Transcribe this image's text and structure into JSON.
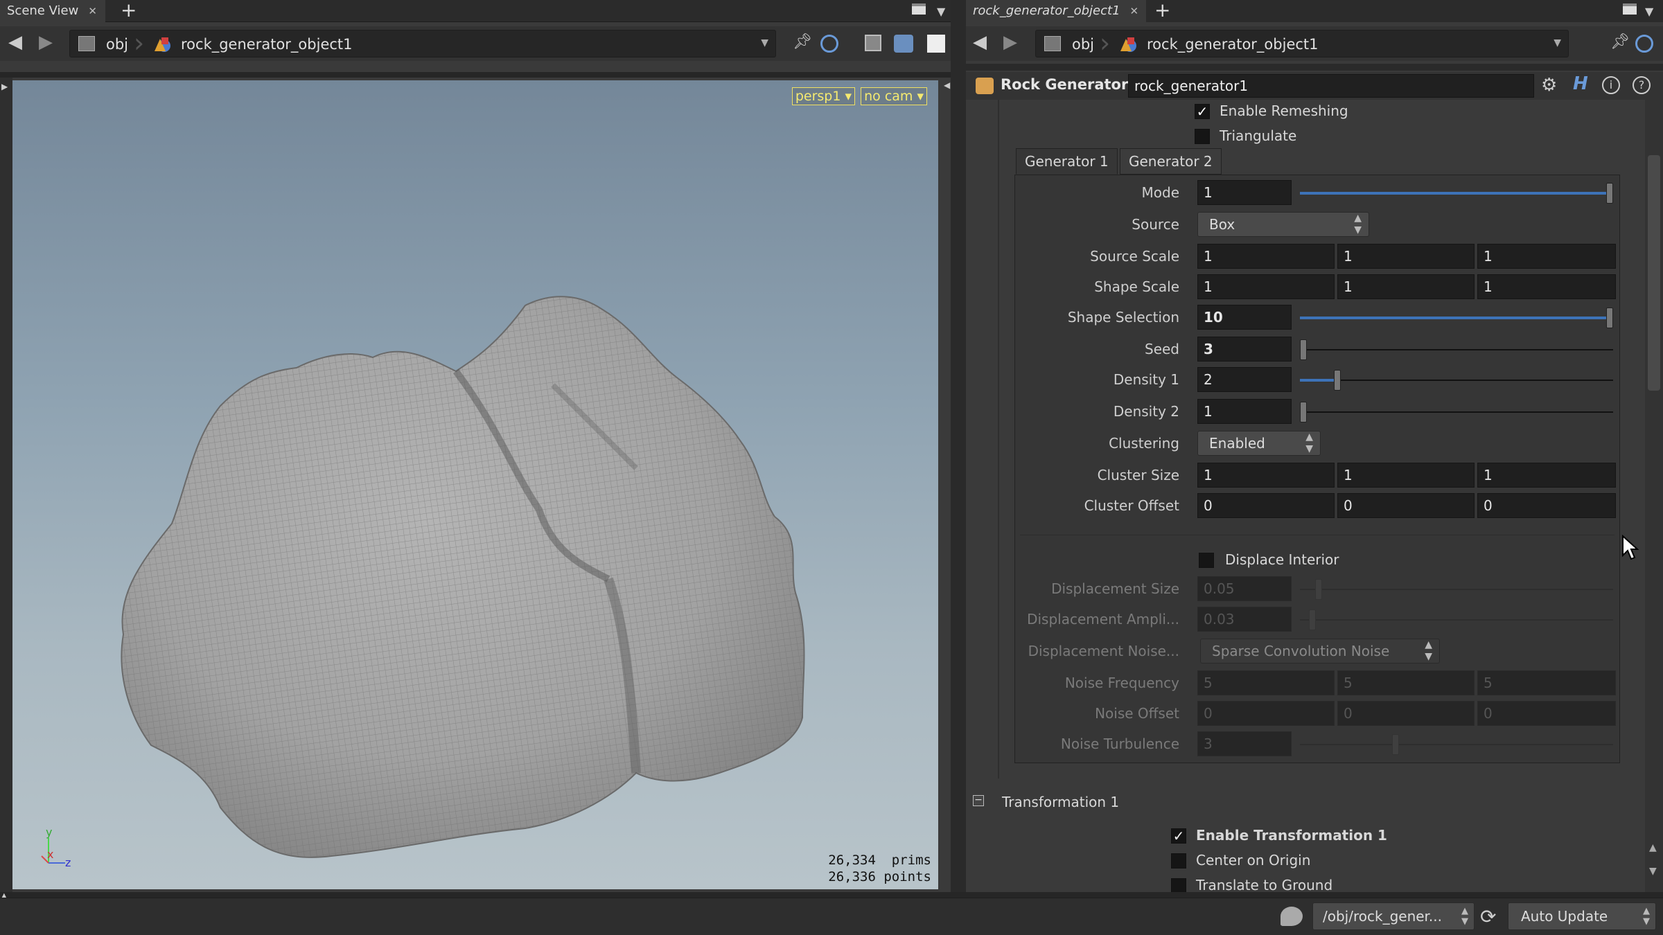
{
  "left_pane": {
    "tab_label": "Scene View",
    "path": {
      "root": "obj",
      "node": "rock_generator_object1"
    },
    "viewport": {
      "camera_menu": "persp1",
      "cam_menu": "no cam",
      "stats_line1": "26,334  prims",
      "stats_line2": "26,336 points",
      "axis_y": "y",
      "axis_x": "x",
      "axis_z": "z"
    }
  },
  "right_pane": {
    "tab_label": "rock_generator_object1",
    "path": {
      "root": "obj",
      "node": "rock_generator_object1"
    },
    "node_type": "Rock Generator",
    "node_name": "rock_generator1",
    "enable_remeshing": {
      "label": "Enable Remeshing",
      "checked": true
    },
    "triangulate": {
      "label": "Triangulate",
      "checked": false
    },
    "tabs": [
      "Generator 1",
      "Generator 2"
    ],
    "params": {
      "mode": {
        "label": "Mode",
        "value": "1",
        "level": 1.0
      },
      "source": {
        "label": "Source",
        "value": "Box"
      },
      "source_scale": {
        "label": "Source Scale",
        "values": [
          "1",
          "1",
          "1"
        ]
      },
      "shape_scale": {
        "label": "Shape Scale",
        "values": [
          "1",
          "1",
          "1"
        ]
      },
      "shape_selection": {
        "label": "Shape Selection",
        "value": "10",
        "level": 1.0
      },
      "seed": {
        "label": "Seed",
        "value": "3",
        "level": 0.0
      },
      "density1": {
        "label": "Density 1",
        "value": "2",
        "level": 0.11
      },
      "density2": {
        "label": "Density 2",
        "value": "1",
        "level": 0.0
      },
      "clustering": {
        "label": "Clustering",
        "value": "Enabled"
      },
      "cluster_size": {
        "label": "Cluster Size",
        "values": [
          "1",
          "1",
          "1"
        ]
      },
      "cluster_offset": {
        "label": "Cluster Offset",
        "values": [
          "0",
          "0",
          "0"
        ]
      },
      "displace_interior": {
        "label": "Displace Interior",
        "checked": false
      },
      "displacement_size": {
        "label": "Displacement Size",
        "value": "0.05",
        "level": 0.05
      },
      "displacement_amplitude": {
        "label": "Displacement Ampli...",
        "value": "0.03",
        "level": 0.03
      },
      "displacement_noise": {
        "label": "Displacement Noise...",
        "value": "Sparse Convolution Noise"
      },
      "noise_frequency": {
        "label": "Noise Frequency",
        "values": [
          "5",
          "5",
          "5"
        ]
      },
      "noise_offset": {
        "label": "Noise Offset",
        "values": [
          "0",
          "0",
          "0"
        ]
      },
      "noise_turbulence": {
        "label": "Noise Turbulence",
        "value": "3",
        "level": 0.3
      }
    },
    "transformation": {
      "folder_label": "Transformation 1",
      "enable": {
        "label": "Enable Transformation 1",
        "checked": true
      },
      "center": {
        "label": "Center on Origin",
        "checked": false
      },
      "translate": {
        "label": "Translate to Ground",
        "checked": false
      }
    }
  },
  "statusbar": {
    "path": "/obj/rock_gener...",
    "update_mode": "Auto Update"
  }
}
